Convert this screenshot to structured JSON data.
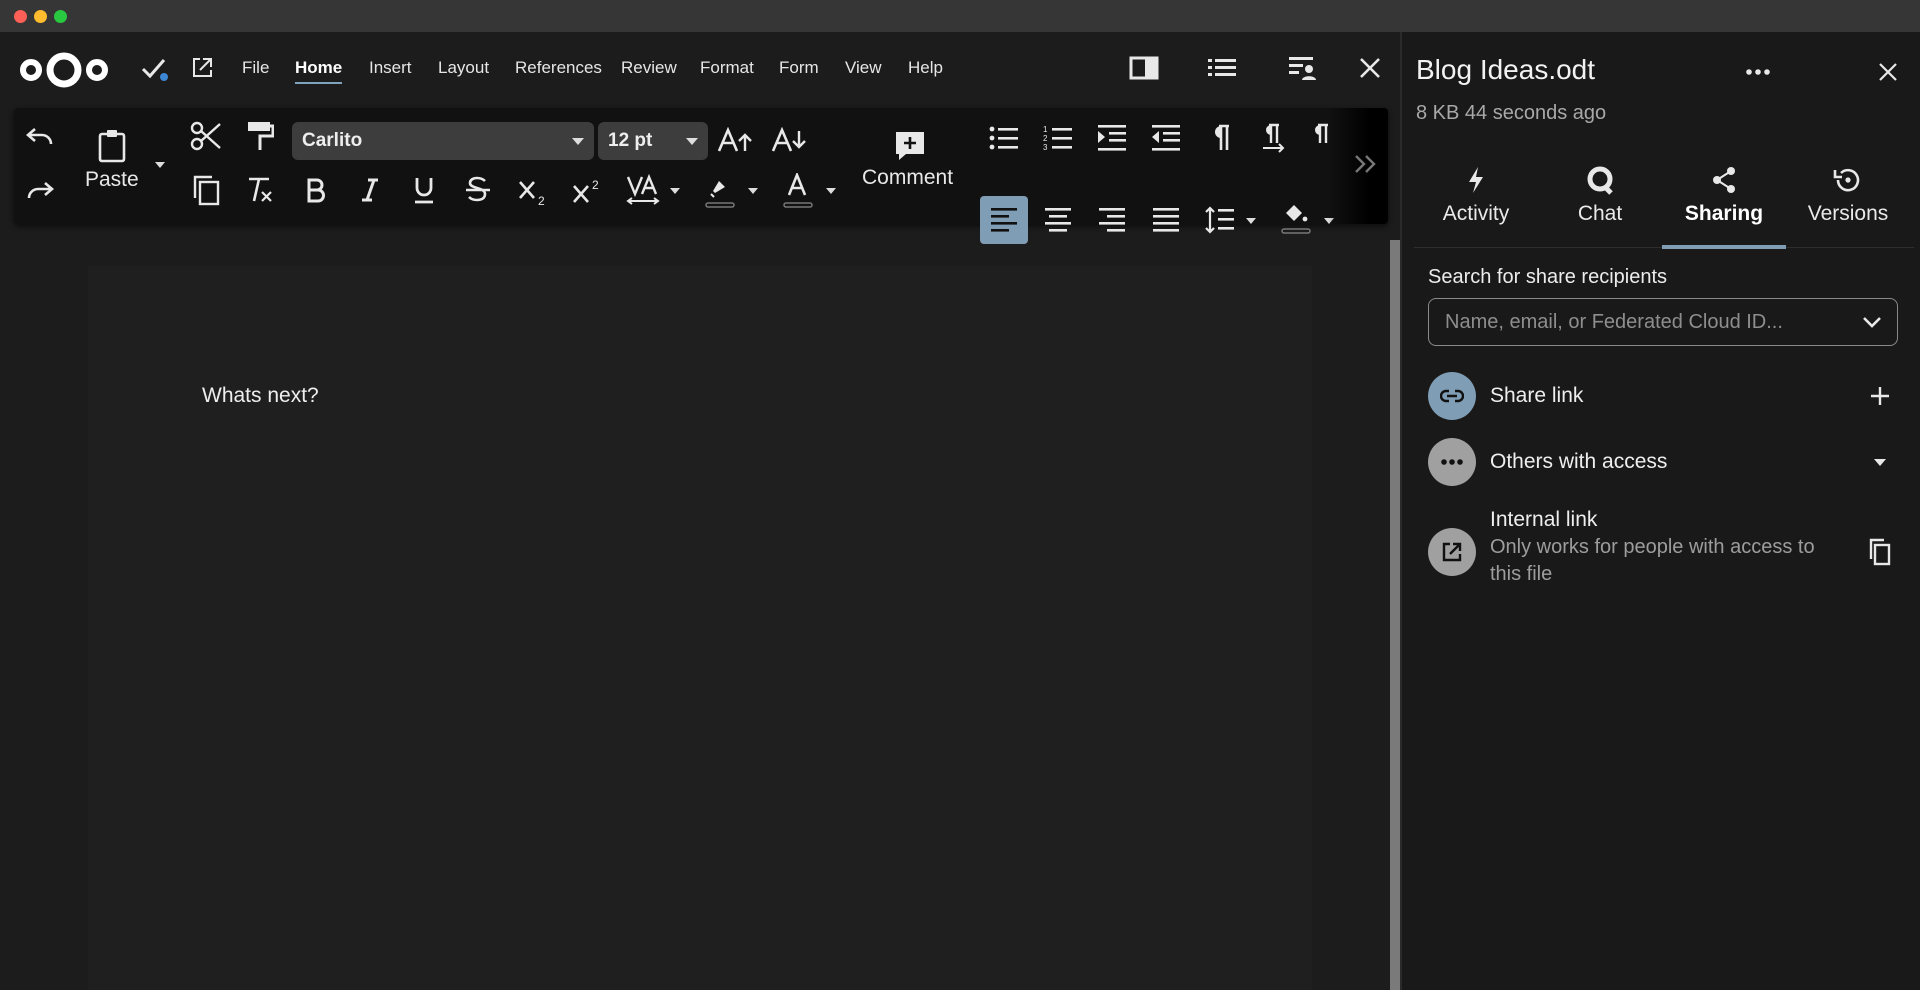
{
  "window": {
    "controls": [
      "close",
      "minimize",
      "zoom"
    ]
  },
  "menubar": {
    "logo": "nextcloud-logo",
    "items": [
      "File",
      "Home",
      "Insert",
      "Layout",
      "References",
      "Review",
      "Format",
      "Form",
      "View",
      "Help"
    ],
    "active": "Home"
  },
  "toolbar": {
    "paste_label": "Paste",
    "font_name": "Carlito",
    "font_size": "12 pt",
    "comment_label": "Comment",
    "active_alignment": "align-left"
  },
  "document": {
    "text": "Whats next?"
  },
  "sidebar": {
    "title": "Blog Ideas.odt",
    "subtitle": "8 KB 44 seconds ago",
    "tabs": [
      {
        "label": "Activity",
        "icon": "flash-icon"
      },
      {
        "label": "Chat",
        "icon": "talk-icon"
      },
      {
        "label": "Sharing",
        "icon": "share-icon"
      },
      {
        "label": "Versions",
        "icon": "history-icon"
      }
    ],
    "active_tab": "Sharing",
    "search": {
      "label": "Search for share recipients",
      "placeholder": "Name, email, or Federated Cloud ID..."
    },
    "share_link": {
      "label": "Share link"
    },
    "others": {
      "label": "Others with access"
    },
    "internal": {
      "label": "Internal link",
      "description": "Only works for people with access to this file"
    }
  },
  "colors": {
    "accent": "#7f9db5",
    "background": "#1c1c1c",
    "share_link_avatar": "#7f9db5",
    "others_avatar": "#a0a0a0"
  }
}
